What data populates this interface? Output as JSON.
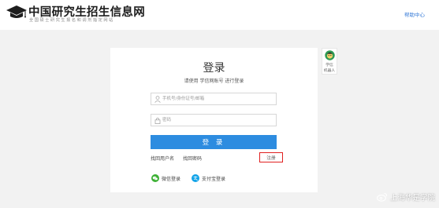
{
  "header": {
    "logo_title": "中国研究生招生信息网",
    "logo_subtitle": "全国硕士研究生报名和调剂指定网站",
    "help_label": "帮助中心"
  },
  "login": {
    "title": "登录",
    "subtitle": "请使用 学信网账号 进行登录",
    "username_placeholder": "手机号/身份证号/邮箱",
    "password_placeholder": "密码",
    "submit_label": "登 录",
    "find_username_label": "找回用户名",
    "find_password_label": "找回密码",
    "register_label": "注册",
    "wechat_label": "微信登录",
    "alipay_label": "支付宝登录"
  },
  "robot": {
    "line1": "学信",
    "line2": "机器人"
  },
  "watermark": {
    "text": "上海华是学院"
  },
  "colors": {
    "primary": "#2d8ce0",
    "highlight_border": "#e02020",
    "wechat": "#3cb034",
    "alipay": "#12a3e8",
    "page_bg": "#f2f2f2"
  }
}
